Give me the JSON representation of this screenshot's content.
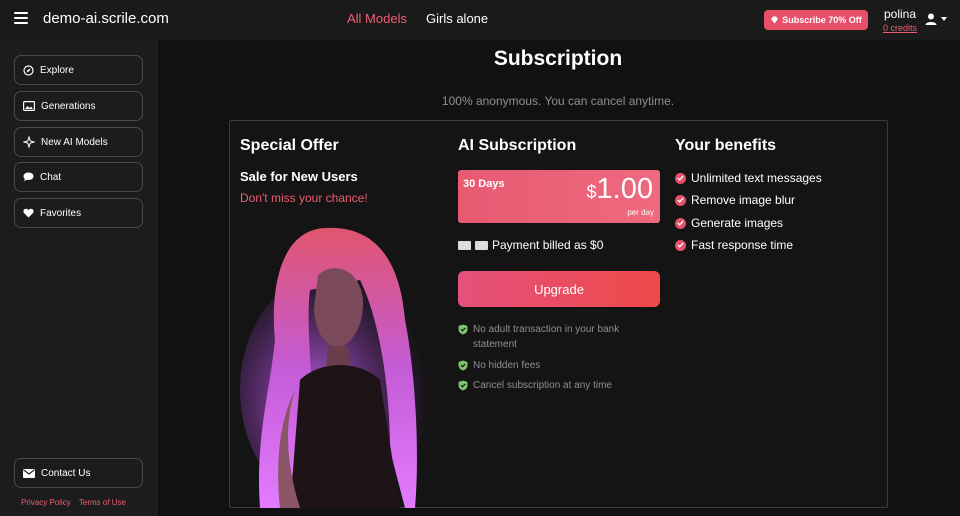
{
  "header": {
    "site_title": "demo-ai.scrile.com",
    "nav": [
      "All Models",
      "Girls alone"
    ],
    "promo_label": "Subscribe 70% Off",
    "user_name": "polina",
    "credits": "0 credits"
  },
  "sidebar": {
    "items": [
      {
        "label": "Explore",
        "icon": "compass-icon"
      },
      {
        "label": "Generations",
        "icon": "image-icon"
      },
      {
        "label": "New AI Models",
        "icon": "sparkle-icon"
      },
      {
        "label": "Chat",
        "icon": "chat-icon"
      },
      {
        "label": "Favorites",
        "icon": "heart-icon"
      }
    ],
    "contact_label": "Contact Us",
    "privacy_label": "Privacy Policy",
    "terms_label": "Terms of Use"
  },
  "main": {
    "title": "Subscription",
    "subtitle": "100% anonymous. You can cancel anytime.",
    "offer": {
      "title": "Special Offer",
      "sale_title": "Sale for New Users",
      "sale_sub": "Don't miss your chance!"
    },
    "subscription": {
      "title": "AI Subscription",
      "days": "30 Days",
      "currency": "$",
      "price": "1.00",
      "unit": "per day",
      "billed": "Payment billed as $0",
      "upgrade_label": "Upgrade",
      "guarantees": [
        "No adult transaction in your bank statement",
        "No hidden fees",
        "Cancel subscription at any time"
      ]
    },
    "benefits": {
      "title": "Your benefits",
      "items": [
        "Unlimited text messages",
        "Remove image blur",
        "Generate images",
        "Fast response time"
      ]
    }
  },
  "colors": {
    "accent": "#e8506a",
    "background": "#111111",
    "sidebar": "#1c1c1c",
    "muted_text": "#8f8f8f",
    "shield_green": "#7dc36b"
  }
}
